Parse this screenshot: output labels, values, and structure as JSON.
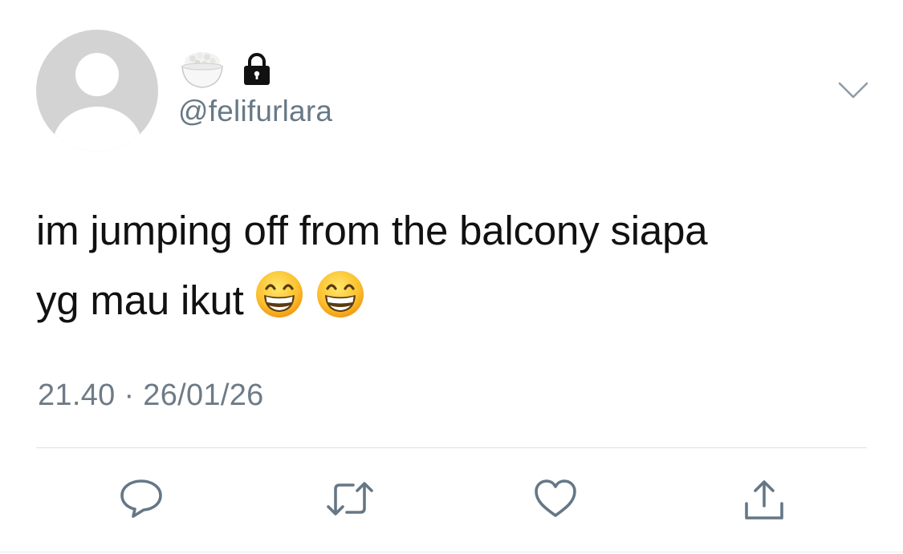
{
  "tweet": {
    "author": {
      "display_name_icons": [
        "rice-bowl-icon",
        "lock-icon"
      ],
      "username": "@felifurlara",
      "avatar": "default-avatar"
    },
    "text_line_1": "im jumping off from the balcony siapa",
    "text_line_2": "yg mau ikut",
    "text_emojis": [
      "grinning-face-icon",
      "grinning-face-icon"
    ],
    "timestamp": "21.40 · 26/01/26",
    "actions": [
      "reply-icon",
      "retweet-icon",
      "like-icon",
      "share-icon"
    ],
    "menu_icon": "chevron-down-icon"
  },
  "colors": {
    "avatar_bg": "#d3d3d3",
    "secondary_text": "#687986",
    "action_icon": "#657786",
    "divider": "#dfe3e7"
  }
}
